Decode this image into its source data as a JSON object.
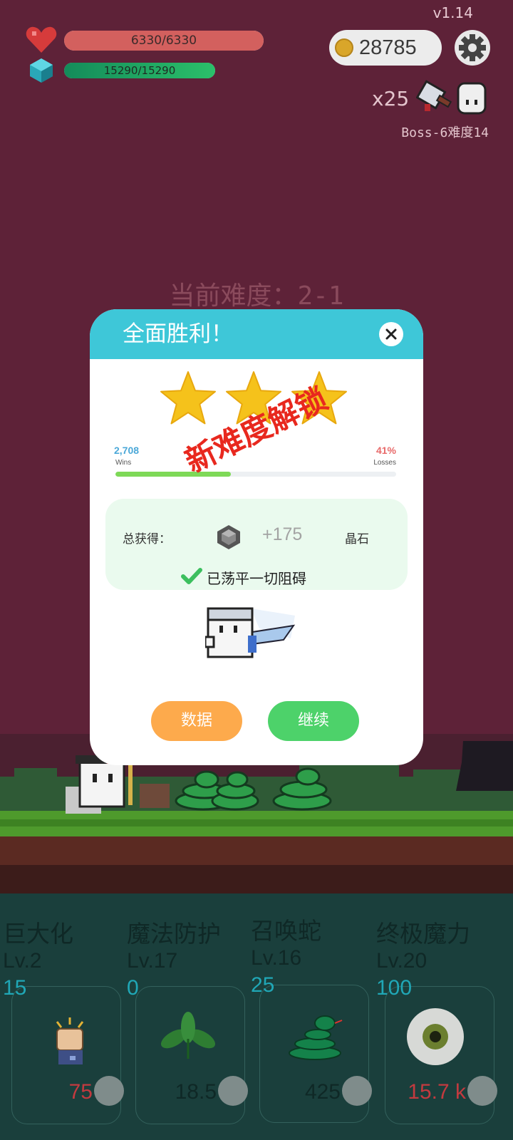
{
  "hud": {
    "version": "v1.14",
    "hp_text": "6330/6330",
    "mp_text": "15290/15290",
    "coins": "28785",
    "multiplier": "x25",
    "boss_label": "Boss-6难度14",
    "current_difficulty": "当前难度：2-1"
  },
  "modal": {
    "title": "全面胜利！",
    "stars": 3,
    "wins_value": "2,708",
    "wins_label": "Wins",
    "losses_value": "41%",
    "losses_label": "Losses",
    "win_fraction": 0.41,
    "stamp": "新难度解锁",
    "reward_label": "总获得：",
    "reward_amount": "+175",
    "reward_unit": "晶石",
    "clear_text": "已荡平一切阻碍",
    "buttons": {
      "data": "数据",
      "continue": "继续"
    }
  },
  "skills": [
    {
      "name": "巨大化",
      "level": "Lv.2",
      "value": "15",
      "cost": "75",
      "cost_color": "#c23a3f",
      "icon": "fist-icon"
    },
    {
      "name": "魔法防护",
      "level": "Lv.17",
      "value": "0",
      "cost": "18.5",
      "cost_color": "#0f2826",
      "icon": "leaf-icon"
    },
    {
      "name": "召唤蛇",
      "level": "Lv.16",
      "value": "25",
      "cost": "425",
      "cost_color": "#0f2826",
      "icon": "snake-icon"
    },
    {
      "name": "终极魔力",
      "level": "Lv.20",
      "value": "100",
      "cost": "15.7 k",
      "cost_color": "#c23a3f",
      "icon": "eye-icon"
    }
  ],
  "colors": {
    "sky": "#5e2238",
    "modal_header": "#3ec7d8",
    "hp": "#e0554f",
    "mp": "#1fa567",
    "star": "#f5c21b",
    "stamp": "#e8281e"
  }
}
